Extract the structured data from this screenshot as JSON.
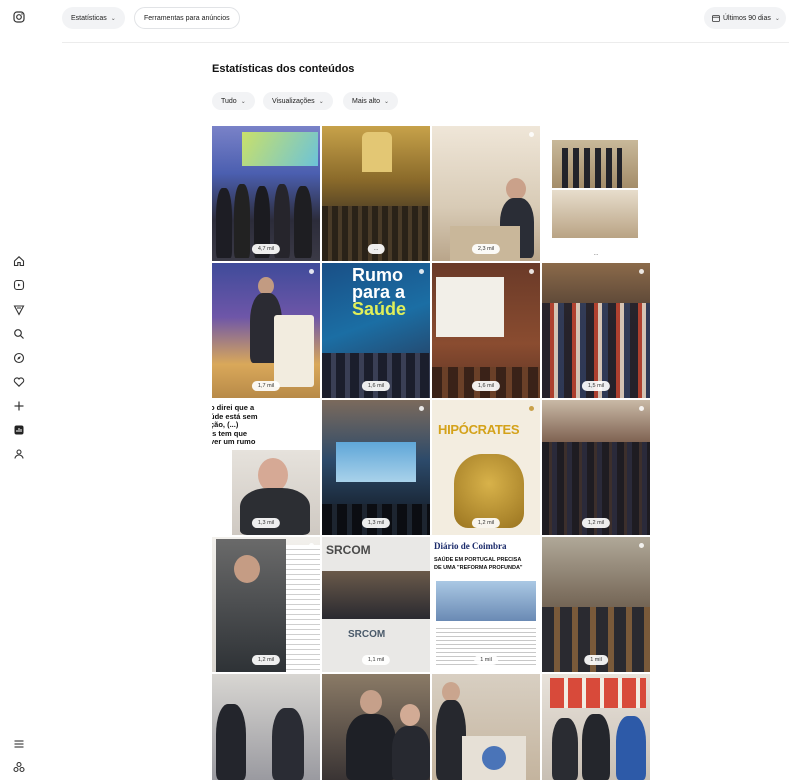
{
  "toolbar": {
    "statistics_label": "Estatísticas",
    "ads_tools_label": "Ferramentas para anúncios",
    "date_range_label": "Últimos 90 dias"
  },
  "content": {
    "title": "Estatísticas dos conteúdos",
    "filters": [
      {
        "label": "Tudo"
      },
      {
        "label": "Visualizações"
      },
      {
        "label": "Mais alto"
      }
    ]
  },
  "sidebar": {
    "icons": [
      "instagram-icon",
      "home-icon",
      "reels-icon",
      "messages-icon",
      "search-icon",
      "explore-icon",
      "notifications-icon",
      "create-icon",
      "dashboard-icon",
      "profile-icon",
      "menu-icon",
      "threads-icon"
    ]
  },
  "grid": {
    "tiles": [
      {
        "views": "4,7 mil"
      },
      {
        "views": "..."
      },
      {
        "views": "2,3 mil"
      },
      {
        "views": "..."
      },
      {
        "views": "1,7 mil"
      },
      {
        "views": "1,6 mil",
        "text": [
          "Rumo",
          "para a",
          "Saúde"
        ]
      },
      {
        "views": "1,6 mil"
      },
      {
        "views": "1,5 mil"
      },
      {
        "views": "1,3 mil",
        "text": [
          "o direi que a",
          "úde está sem",
          "ção, (...)",
          "ís tem que",
          "ver um rumo"
        ]
      },
      {
        "views": "1,3 mil"
      },
      {
        "views": "1,2 mil",
        "text": [
          "HIPÓCRATES"
        ]
      },
      {
        "views": "1,2 mil"
      },
      {
        "views": "1,2 mil"
      },
      {
        "views": "1,1 mil",
        "text": [
          "SRCOM",
          "SRCOM"
        ]
      },
      {
        "views": "1 mil",
        "text": [
          "Diário de Coimbra",
          "SAÚDE EM PORTUGAL PRECISA",
          "DE UMA \"REFORMA PROFUNDA\""
        ]
      },
      {
        "views": "1 mil"
      },
      {
        "views": ""
      },
      {
        "views": ""
      },
      {
        "views": ""
      },
      {
        "views": ""
      }
    ]
  }
}
